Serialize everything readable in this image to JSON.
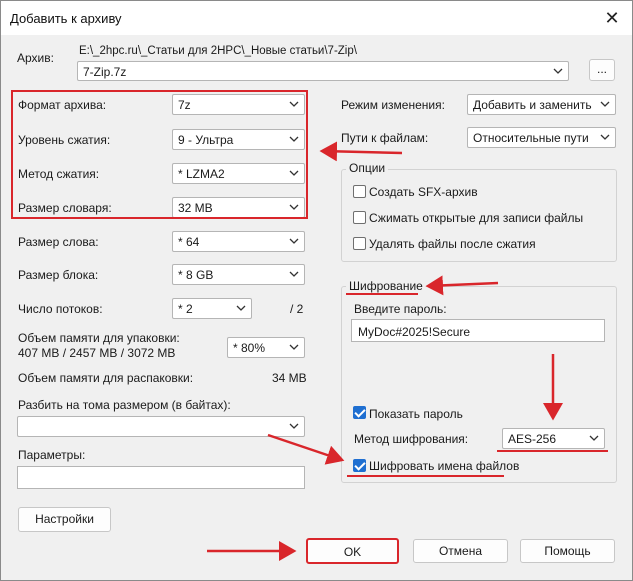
{
  "window": {
    "title": "Добавить к архиву",
    "close_icon": "close-icon"
  },
  "archive": {
    "label": "Архив:",
    "path": "E:\\_2hpc.ru\\_Статьи для 2HPC\\_Новые статьи\\7-Zip\\",
    "name": "7-Zip.7z",
    "browse_label": "..."
  },
  "left": {
    "format": {
      "label": "Формат архива:",
      "value": "7z"
    },
    "level": {
      "label": "Уровень сжатия:",
      "value": "9 - Ультра"
    },
    "method": {
      "label": "Метод сжатия:",
      "value": "*  LZMA2"
    },
    "dict": {
      "label": "Размер словаря:",
      "value": "32 MB"
    },
    "word": {
      "label": "Размер слова:",
      "value": "*  64"
    },
    "block": {
      "label": "Размер блока:",
      "value": "*  8 GB"
    },
    "threads": {
      "label": "Число потоков:",
      "value": "*  2",
      "max": "/ 2"
    },
    "mem_pack": {
      "label": "Объем памяти для упаковки:",
      "sub": "407 MB / 2457 MB / 3072 MB",
      "value": "*  80%"
    },
    "mem_unpack": {
      "label": "Объем памяти для распаковки:",
      "value": "34 MB"
    },
    "split": {
      "label": "Разбить на тома размером (в байтах):",
      "value": ""
    },
    "params": {
      "label": "Параметры:",
      "value": ""
    },
    "settings_label": "Настройки"
  },
  "right": {
    "update_mode": {
      "label": "Режим изменения:",
      "value": "Добавить и заменить"
    },
    "path_mode": {
      "label": "Пути к файлам:",
      "value": "Относительные пути"
    },
    "options": {
      "title": "Опции",
      "items": [
        {
          "label": "Создать SFX-архив",
          "checked": false
        },
        {
          "label": "Сжимать открытые для записи файлы",
          "checked": false
        },
        {
          "label": "Удалять файлы после сжатия",
          "checked": false
        }
      ]
    },
    "encryption": {
      "title": "Шифрование",
      "password_label": "Введите пароль:",
      "password": "MyDoc#2025!Secure",
      "show_password": {
        "label": "Показать пароль",
        "checked": true
      },
      "method": {
        "label": "Метод шифрования:",
        "value": "AES-256"
      },
      "encrypt_names": {
        "label": "Шифровать имена файлов",
        "checked": true
      }
    }
  },
  "buttons": {
    "ok": "OK",
    "cancel": "Отмена",
    "help": "Помощь"
  },
  "colors": {
    "highlight": "#d9262b",
    "check": "#1f6fd1",
    "dialog_bg": "#f0f0f0"
  }
}
